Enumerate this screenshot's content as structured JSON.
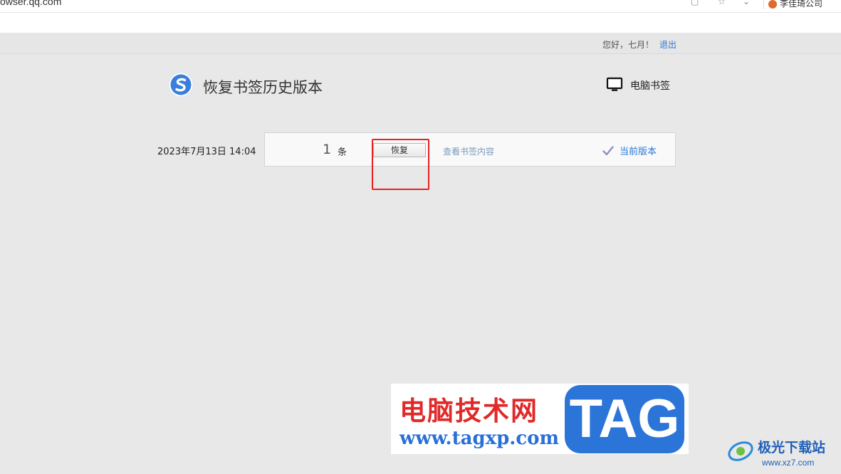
{
  "browser": {
    "url": "owser.qq.com",
    "profile_label": "李佳琦公司"
  },
  "user_bar": {
    "greeting": "您好，七月！",
    "logout_label": "退出"
  },
  "header": {
    "title": "恢复书签历史版本",
    "pc_bookmarks_label": "电脑书签"
  },
  "versions": [
    {
      "date": "2023年7月13日 14:04",
      "count": "1",
      "count_unit": "条",
      "restore_label": "恢复",
      "view_label": "查看书签内容",
      "current_label": "当前版本"
    }
  ],
  "watermark": {
    "title": "电脑技术网",
    "url": "www.tagxp.com",
    "tag": "TAG",
    "corner_text": "极光下载站",
    "corner_url": "www.xz7.com"
  },
  "colors": {
    "accent": "#2a7ad6",
    "highlight": "#e52222",
    "background": "#e8e8e8"
  }
}
